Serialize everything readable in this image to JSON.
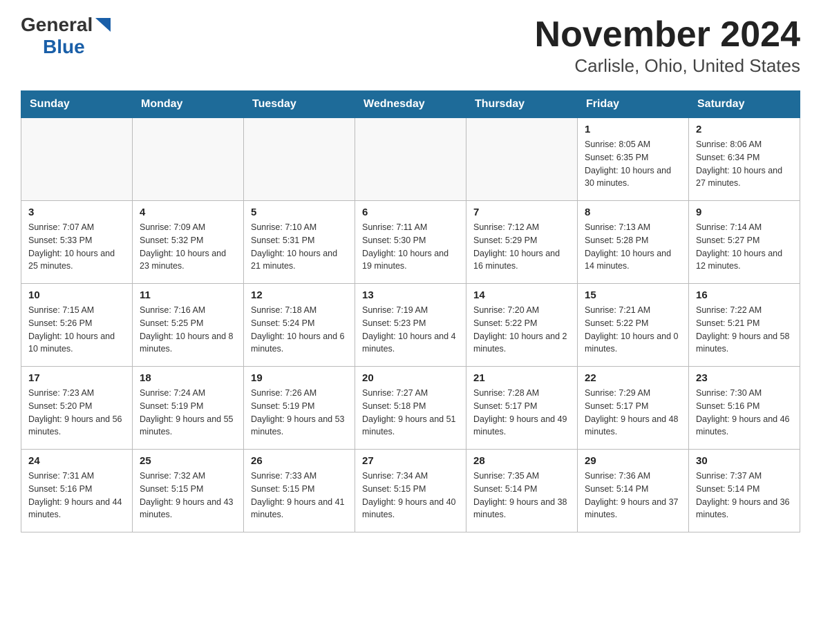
{
  "header": {
    "logo_general": "General",
    "logo_blue": "Blue",
    "title": "November 2024",
    "subtitle": "Carlisle, Ohio, United States"
  },
  "days_of_week": [
    "Sunday",
    "Monday",
    "Tuesday",
    "Wednesday",
    "Thursday",
    "Friday",
    "Saturday"
  ],
  "weeks": [
    [
      {
        "day": "",
        "info": ""
      },
      {
        "day": "",
        "info": ""
      },
      {
        "day": "",
        "info": ""
      },
      {
        "day": "",
        "info": ""
      },
      {
        "day": "",
        "info": ""
      },
      {
        "day": "1",
        "info": "Sunrise: 8:05 AM\nSunset: 6:35 PM\nDaylight: 10 hours and 30 minutes."
      },
      {
        "day": "2",
        "info": "Sunrise: 8:06 AM\nSunset: 6:34 PM\nDaylight: 10 hours and 27 minutes."
      }
    ],
    [
      {
        "day": "3",
        "info": "Sunrise: 7:07 AM\nSunset: 5:33 PM\nDaylight: 10 hours and 25 minutes."
      },
      {
        "day": "4",
        "info": "Sunrise: 7:09 AM\nSunset: 5:32 PM\nDaylight: 10 hours and 23 minutes."
      },
      {
        "day": "5",
        "info": "Sunrise: 7:10 AM\nSunset: 5:31 PM\nDaylight: 10 hours and 21 minutes."
      },
      {
        "day": "6",
        "info": "Sunrise: 7:11 AM\nSunset: 5:30 PM\nDaylight: 10 hours and 19 minutes."
      },
      {
        "day": "7",
        "info": "Sunrise: 7:12 AM\nSunset: 5:29 PM\nDaylight: 10 hours and 16 minutes."
      },
      {
        "day": "8",
        "info": "Sunrise: 7:13 AM\nSunset: 5:28 PM\nDaylight: 10 hours and 14 minutes."
      },
      {
        "day": "9",
        "info": "Sunrise: 7:14 AM\nSunset: 5:27 PM\nDaylight: 10 hours and 12 minutes."
      }
    ],
    [
      {
        "day": "10",
        "info": "Sunrise: 7:15 AM\nSunset: 5:26 PM\nDaylight: 10 hours and 10 minutes."
      },
      {
        "day": "11",
        "info": "Sunrise: 7:16 AM\nSunset: 5:25 PM\nDaylight: 10 hours and 8 minutes."
      },
      {
        "day": "12",
        "info": "Sunrise: 7:18 AM\nSunset: 5:24 PM\nDaylight: 10 hours and 6 minutes."
      },
      {
        "day": "13",
        "info": "Sunrise: 7:19 AM\nSunset: 5:23 PM\nDaylight: 10 hours and 4 minutes."
      },
      {
        "day": "14",
        "info": "Sunrise: 7:20 AM\nSunset: 5:22 PM\nDaylight: 10 hours and 2 minutes."
      },
      {
        "day": "15",
        "info": "Sunrise: 7:21 AM\nSunset: 5:22 PM\nDaylight: 10 hours and 0 minutes."
      },
      {
        "day": "16",
        "info": "Sunrise: 7:22 AM\nSunset: 5:21 PM\nDaylight: 9 hours and 58 minutes."
      }
    ],
    [
      {
        "day": "17",
        "info": "Sunrise: 7:23 AM\nSunset: 5:20 PM\nDaylight: 9 hours and 56 minutes."
      },
      {
        "day": "18",
        "info": "Sunrise: 7:24 AM\nSunset: 5:19 PM\nDaylight: 9 hours and 55 minutes."
      },
      {
        "day": "19",
        "info": "Sunrise: 7:26 AM\nSunset: 5:19 PM\nDaylight: 9 hours and 53 minutes."
      },
      {
        "day": "20",
        "info": "Sunrise: 7:27 AM\nSunset: 5:18 PM\nDaylight: 9 hours and 51 minutes."
      },
      {
        "day": "21",
        "info": "Sunrise: 7:28 AM\nSunset: 5:17 PM\nDaylight: 9 hours and 49 minutes."
      },
      {
        "day": "22",
        "info": "Sunrise: 7:29 AM\nSunset: 5:17 PM\nDaylight: 9 hours and 48 minutes."
      },
      {
        "day": "23",
        "info": "Sunrise: 7:30 AM\nSunset: 5:16 PM\nDaylight: 9 hours and 46 minutes."
      }
    ],
    [
      {
        "day": "24",
        "info": "Sunrise: 7:31 AM\nSunset: 5:16 PM\nDaylight: 9 hours and 44 minutes."
      },
      {
        "day": "25",
        "info": "Sunrise: 7:32 AM\nSunset: 5:15 PM\nDaylight: 9 hours and 43 minutes."
      },
      {
        "day": "26",
        "info": "Sunrise: 7:33 AM\nSunset: 5:15 PM\nDaylight: 9 hours and 41 minutes."
      },
      {
        "day": "27",
        "info": "Sunrise: 7:34 AM\nSunset: 5:15 PM\nDaylight: 9 hours and 40 minutes."
      },
      {
        "day": "28",
        "info": "Sunrise: 7:35 AM\nSunset: 5:14 PM\nDaylight: 9 hours and 38 minutes."
      },
      {
        "day": "29",
        "info": "Sunrise: 7:36 AM\nSunset: 5:14 PM\nDaylight: 9 hours and 37 minutes."
      },
      {
        "day": "30",
        "info": "Sunrise: 7:37 AM\nSunset: 5:14 PM\nDaylight: 9 hours and 36 minutes."
      }
    ]
  ]
}
